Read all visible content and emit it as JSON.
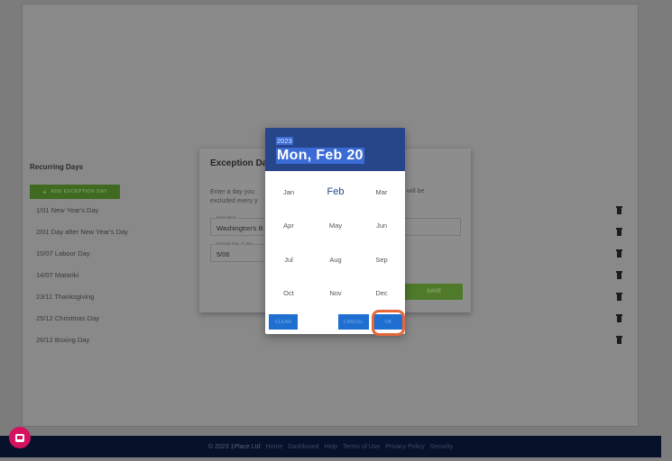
{
  "recurring": {
    "section_title": "Recurring Days",
    "add_label": "ADD EXCEPTION DAY",
    "days": [
      {
        "label": "1/01 New Year's Day"
      },
      {
        "label": "2/01 Day after New Year's Day"
      },
      {
        "label": "10/07 Labour Day"
      },
      {
        "label": "14/07 Matariki"
      },
      {
        "label": "23/11 Thanksgiving"
      },
      {
        "label": "25/12 Christmas Day"
      },
      {
        "label": "26/12 Boxing Day"
      }
    ]
  },
  "exception_dialog": {
    "title": "Exception Da",
    "text_left": "Enter a day you excluded every y",
    "text_right": "will be",
    "description_label": "Description",
    "description_value": "Washington's B",
    "exclude_label": "Exclude Day of year",
    "exclude_value": "5/06",
    "save_label": "SAVE"
  },
  "picker": {
    "year": "2023",
    "selected_date": "Mon, Feb 20",
    "months": [
      "Jan",
      "Feb",
      "Mar",
      "Apr",
      "May",
      "Jun",
      "Jul",
      "Aug",
      "Sep",
      "Oct",
      "Nov",
      "Dec"
    ],
    "selected_month": "Feb",
    "clear_label": "CLEAR",
    "cancel_label": "CANCEL",
    "ok_label": "OK"
  },
  "footer": {
    "copyright": "© 2023 1Place Ltd",
    "links": [
      "Home",
      "Dashboard",
      "Help",
      "Terms of Use",
      "Privacy Policy",
      "Security"
    ]
  },
  "colors": {
    "picker_header": "#27468a",
    "button_blue": "#1e6fd0",
    "highlight": "#e4683a",
    "save_green": "#4f7a29"
  }
}
